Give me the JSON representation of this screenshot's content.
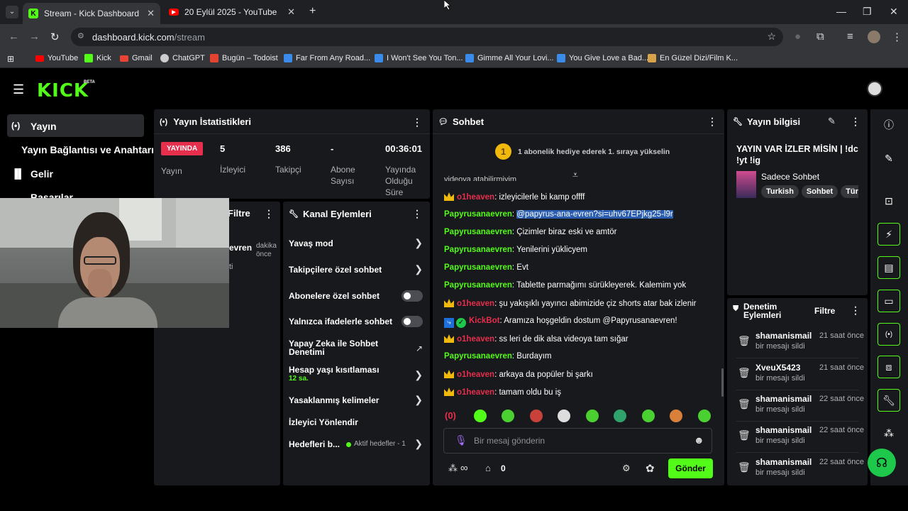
{
  "browser": {
    "tabs": [
      {
        "title": "Stream - Kick Dashboard"
      },
      {
        "title": "20 Eylül 2025 - YouTube"
      }
    ],
    "url_host": "dashboard.kick.com",
    "url_path": "/stream",
    "bookmarks": [
      "YouTube",
      "Kick",
      "Gmail",
      "ChatGPT",
      "Bugün – Todoist",
      "Far From Any Road...",
      "I Won't See You Ton...",
      "Gimme All Your Lovi...",
      "You Give Love a Bad...",
      "En Güzel Dizi/Film K..."
    ]
  },
  "app": {
    "logo": "KICK",
    "beta": "BETA"
  },
  "sidebar": {
    "items": [
      "Yayın",
      "Yayın Bağlantısı ve Anahtarı",
      "Gelir",
      "Başarılar"
    ]
  },
  "stats": {
    "title": "Yayın İstatistikleri",
    "live_badge": "YAYINDA",
    "live_label": "Yayın",
    "items": [
      {
        "value": "5",
        "label": "İzleyici"
      },
      {
        "value": "386",
        "label": "Takipçi"
      },
      {
        "value": "-",
        "label": "Abone Sayısı"
      },
      {
        "value": "00:36:01",
        "label": "Yayında Olduğu Süre"
      }
    ]
  },
  "filter_panel": {
    "title": "Filtre",
    "row_name": "evren",
    "row_time": "dakika önce",
    "row_extra": "ti"
  },
  "channel_actions": {
    "title": "Kanal Eylemleri",
    "items": [
      "Yavaş mod",
      "Takipçilere özel sohbet",
      "Abonelere özel sohbet",
      "Yalnızca ifadelerle sohbet",
      "Yapay Zeka ile Sohbet Denetimi",
      "Hesap yaşı kısıtlaması",
      "Yasaklanmış kelimeler",
      "İzleyici Yönlendir",
      "Hedefleri b..."
    ],
    "age_value": "12 sa.",
    "goals_status": "Aktif hedefler - 1"
  },
  "chat": {
    "title": "Sohbet",
    "rank_number": "1",
    "rank_text": "1 abonelik hediye ederek 1. sıraya yükselin",
    "cut_line": "videoya atabilirmiyim",
    "messages": [
      {
        "user": "o1heaven",
        "text": ": izleyicilerle bi kamp offff"
      },
      {
        "user": "Papyrusanaevren",
        "text": ": ",
        "link": "@papyrus-ana-evren?si=uhv67EPjkg25-l9r"
      },
      {
        "user": "Papyrusanaevren",
        "text": ": Çizimler biraz eski ve amtör"
      },
      {
        "user": "Papyrusanaevren",
        "text": ": Yenilerini yüklicyem"
      },
      {
        "user": "Papyrusanaevren",
        "text": ": Evt"
      },
      {
        "user": "Papyrusanaevren",
        "text": ": Tablette parmağımı sürükleyerek. Kalemim yok"
      },
      {
        "user": "o1heaven",
        "text": ": şu yakışıklı yayıncı abimizide çiz shorts atar bak izlenir"
      },
      {
        "user": "KickBot",
        "text": ": Aramıza hoşgeldin dostum @Papyrusanaevren!"
      },
      {
        "user": "o1heaven",
        "text": ": ss leri de dik alsa videoya tam sığar"
      },
      {
        "user": "Papyrusanaevren",
        "text": ": Burdayım"
      },
      {
        "user": "o1heaven",
        "text": ": arkaya da popüler bi şarkı"
      },
      {
        "user": "o1heaven",
        "text": ": tamam oldu bu iş"
      }
    ],
    "emote_first": "(0)",
    "input_placeholder": "Bir mesaj gönderin",
    "points": "∞",
    "store_count": "0",
    "send_label": "Gönder"
  },
  "stream_info": {
    "title": "Yayın bilgisi",
    "stream_title": "YAYIN VAR İZLER MİSİN | !dc !yt !ig",
    "category": "Sadece Sohbet",
    "tags": [
      "Turkish",
      "Sohbet",
      "Türk"
    ]
  },
  "mod_actions": {
    "title": "Denetim Eylemleri",
    "filter": "Filtre",
    "items": [
      {
        "user": "shamanismail",
        "time": "21 saat önce",
        "action": "bir mesajı sildi"
      },
      {
        "user": "XveuX5423",
        "time": "21 saat önce",
        "action": "bir mesajı sildi"
      },
      {
        "user": "shamanismail",
        "time": "22 saat önce",
        "action": "bir mesajı sildi"
      },
      {
        "user": "shamanismail",
        "time": "22 saat önce",
        "action": "bir mesajı sildi"
      },
      {
        "user": "shamanismail",
        "time": "22 saat önce",
        "action": "bir mesajı sildi"
      }
    ]
  },
  "colors": {
    "accent": "#53fc18",
    "live": "#e62e4d",
    "gold": "#f2b90d"
  }
}
